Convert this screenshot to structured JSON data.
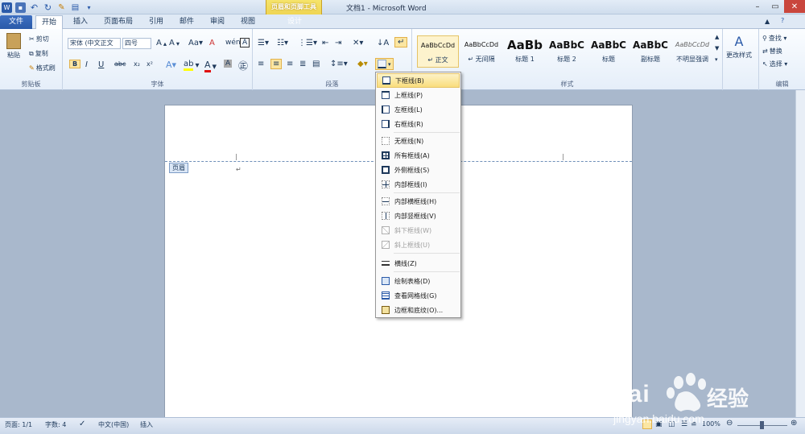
{
  "window": {
    "title": "文档1 - Microsoft Word",
    "context_group": "页眉和页脚工具",
    "context_tab": "设计"
  },
  "tabs": [
    "文件",
    "开始",
    "插入",
    "页面布局",
    "引用",
    "邮件",
    "审阅",
    "视图"
  ],
  "clipboard": {
    "paste": "粘贴",
    "cut": "剪切",
    "copy": "复制",
    "format_painter": "格式刷",
    "label": "剪贴板"
  },
  "font": {
    "name": "宋体 (中文正文",
    "size": "四号",
    "label": "字体",
    "bold": "B",
    "italic": "I",
    "underline": "U",
    "strike": "abc",
    "sub": "x₂",
    "sup": "x²"
  },
  "paragraph": {
    "label": "段落"
  },
  "styles": {
    "label": "样式",
    "items": [
      {
        "preview": "AaBbCcDd",
        "name": "↵ 正文"
      },
      {
        "preview": "AaBbCcDd",
        "name": "↵ 无间隔"
      },
      {
        "preview": "AaBb",
        "name": "标题 1"
      },
      {
        "preview": "AaBbC",
        "name": "标题 2"
      },
      {
        "preview": "AaBbC",
        "name": "标题"
      },
      {
        "preview": "AaBbC",
        "name": "副标题"
      },
      {
        "preview": "AaBbCcDd",
        "name": "不明显强调"
      }
    ],
    "change": "更改样式"
  },
  "editing": {
    "label": "编辑",
    "find": "查找 ▾",
    "replace": "替换",
    "select": "选择 ▾"
  },
  "document": {
    "header_tag": "页眉",
    "caret": "↵"
  },
  "border_menu": {
    "items": [
      {
        "label": "下框线(B)",
        "state": "highlighted"
      },
      {
        "label": "上框线(P)",
        "state": "normal"
      },
      {
        "label": "左框线(L)",
        "state": "normal"
      },
      {
        "label": "右框线(R)",
        "state": "normal"
      },
      {
        "label": "无框线(N)",
        "state": "normal"
      },
      {
        "label": "所有框线(A)",
        "state": "normal"
      },
      {
        "label": "外侧框线(S)",
        "state": "normal"
      },
      {
        "label": "内部框线(I)",
        "state": "normal"
      },
      {
        "label": "内部横框线(H)",
        "state": "normal"
      },
      {
        "label": "内部竖框线(V)",
        "state": "normal"
      },
      {
        "label": "斜下框线(W)",
        "state": "disabled"
      },
      {
        "label": "斜上框线(U)",
        "state": "disabled"
      },
      {
        "label": "横线(Z)",
        "state": "normal"
      },
      {
        "label": "绘制表格(D)",
        "state": "normal"
      },
      {
        "label": "查看网格线(G)",
        "state": "normal"
      },
      {
        "label": "边框和底纹(O)...",
        "state": "normal"
      }
    ]
  },
  "status": {
    "page": "页面: 1/1",
    "words": "字数: 4",
    "lang": "中文(中国)",
    "mode": "插入",
    "zoom": "100%"
  },
  "watermark": {
    "text1": "Bai",
    "text2": "经验",
    "url": "jingyan.baidu.com"
  },
  "colors": {
    "accent": "#2a5aa9",
    "highlight": "#f9dd7d",
    "context": "#e7c53c"
  }
}
